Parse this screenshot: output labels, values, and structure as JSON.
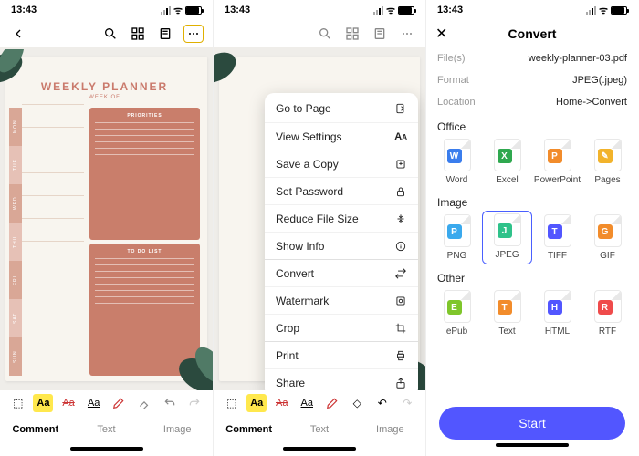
{
  "status": {
    "time": "13:43"
  },
  "planner": {
    "title": "WEEKLY PLANNER",
    "subtitle": "WEEK OF",
    "days": [
      "MON",
      "TUE",
      "WED",
      "THU",
      "FRI",
      "SAT",
      "SUN"
    ],
    "card1_title": "PRIORITIES",
    "card2_title": "TO DO LIST"
  },
  "tabs": {
    "comment": "Comment",
    "text": "Text",
    "image": "Image"
  },
  "menu": {
    "go_to_page": "Go to Page",
    "view_settings": "View Settings",
    "save_copy": "Save a Copy",
    "set_password": "Set Password",
    "reduce": "Reduce File Size",
    "show_info": "Show Info",
    "convert": "Convert",
    "watermark": "Watermark",
    "crop": "Crop",
    "print": "Print",
    "share": "Share"
  },
  "convert": {
    "title": "Convert",
    "files_label": "File(s)",
    "files_value": "weekly-planner-03.pdf",
    "format_label": "Format",
    "format_value": "JPEG(.jpeg)",
    "location_label": "Location",
    "location_value": "Home->Convert",
    "office_label": "Office",
    "image_label": "Image",
    "other_label": "Other",
    "start": "Start",
    "formats": {
      "word": "Word",
      "excel": "Excel",
      "ppt": "PowerPoint",
      "pages": "Pages",
      "png": "PNG",
      "jpeg": "JPEG",
      "tiff": "TIFF",
      "gif": "GIF",
      "epub": "ePub",
      "text": "Text",
      "html": "HTML",
      "rtf": "RTF"
    }
  }
}
